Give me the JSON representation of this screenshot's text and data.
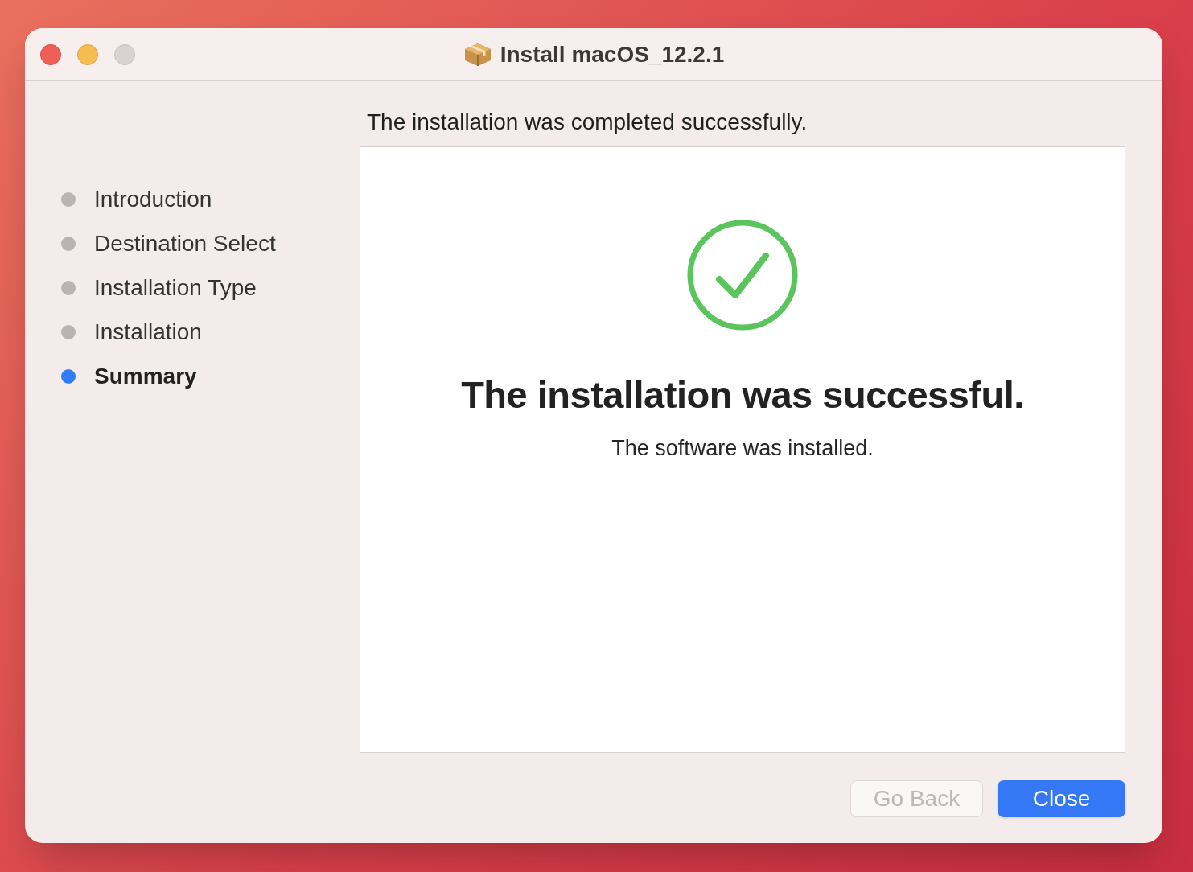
{
  "window": {
    "title": "Install macOS_12.2.1"
  },
  "steps": [
    {
      "label": "Introduction",
      "selected": false
    },
    {
      "label": "Destination Select",
      "selected": false
    },
    {
      "label": "Installation Type",
      "selected": false
    },
    {
      "label": "Installation",
      "selected": false
    },
    {
      "label": "Summary",
      "selected": true
    }
  ],
  "header": "The installation was completed successfully.",
  "panel": {
    "heading": "The installation was successful.",
    "message": "The software was installed."
  },
  "buttons": [
    {
      "label": "Go Back",
      "disabled": true,
      "default": false
    },
    {
      "label": "Close",
      "disabled": false,
      "default": true
    }
  ]
}
